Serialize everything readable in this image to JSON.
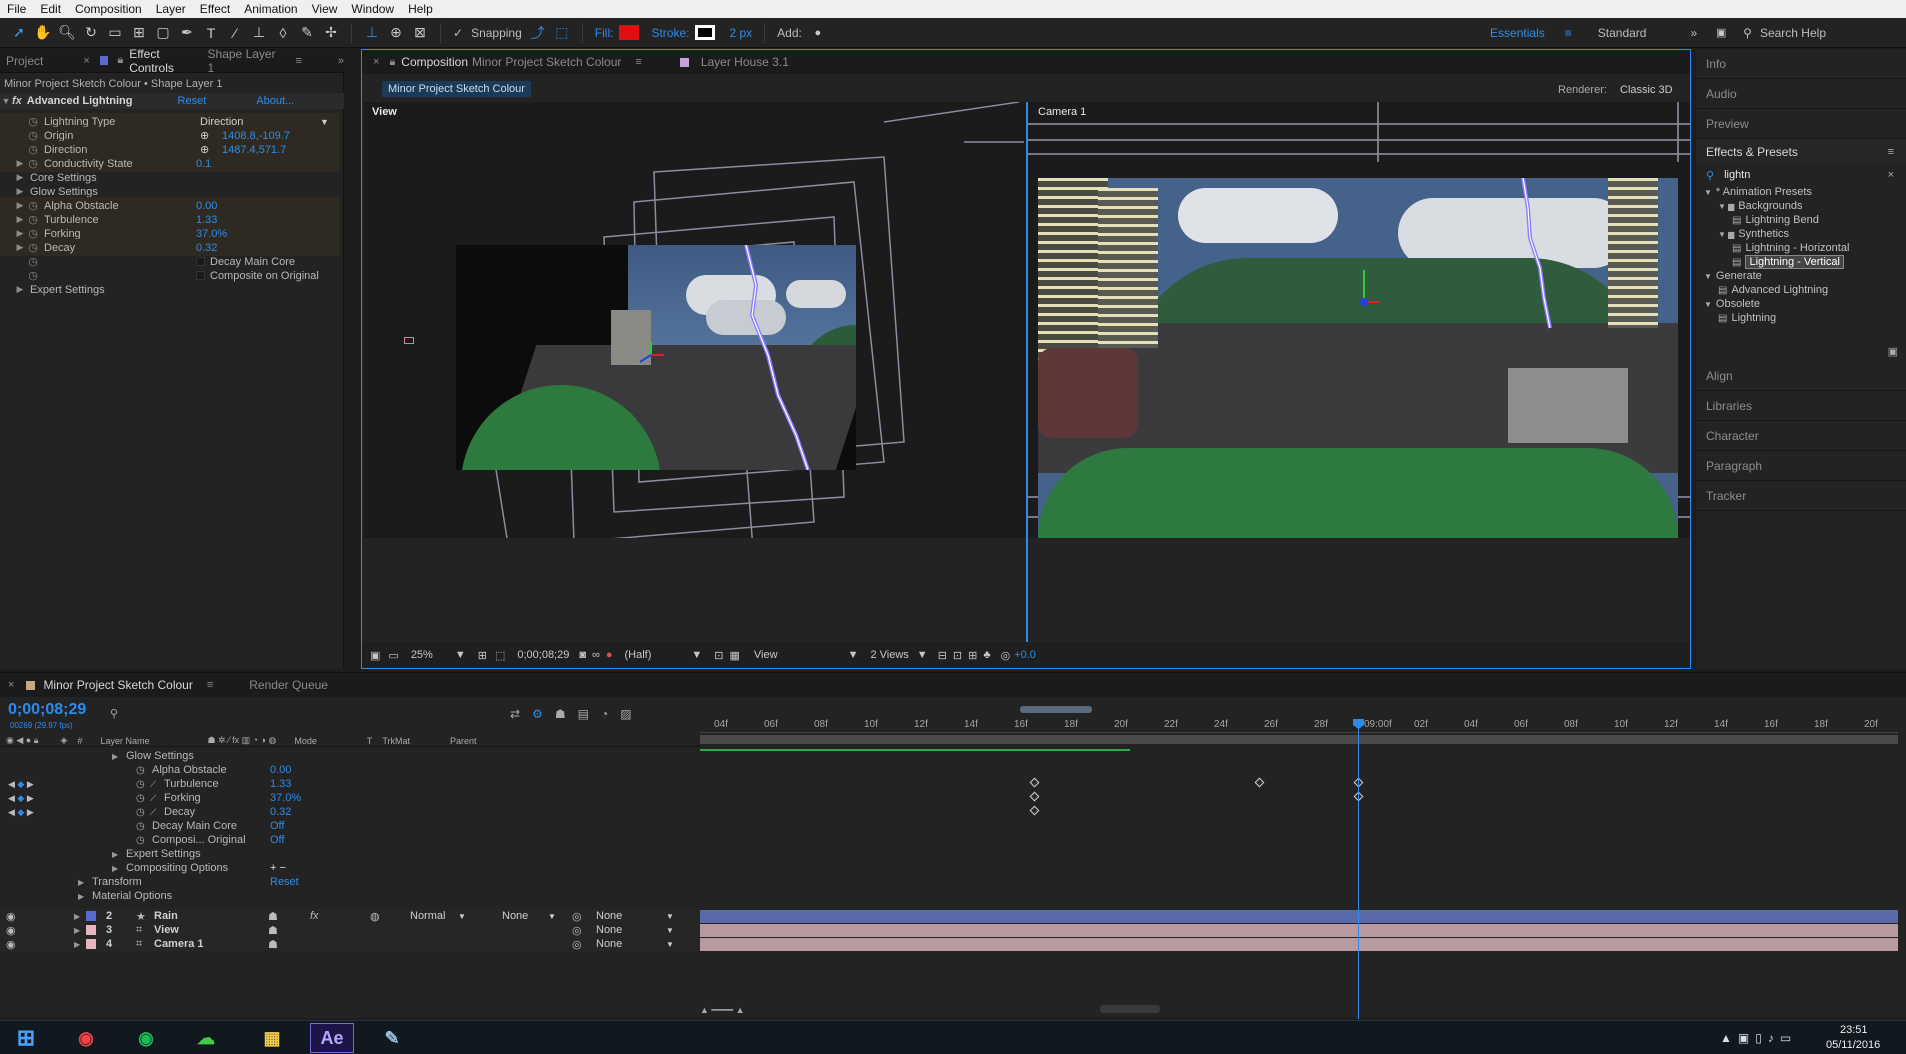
{
  "menu": [
    "File",
    "Edit",
    "Composition",
    "Layer",
    "Effect",
    "Animation",
    "View",
    "Window",
    "Help"
  ],
  "toolbar": {
    "snapping_label": "Snapping",
    "fill_label": "Fill:",
    "stroke_label": "Stroke:",
    "stroke_width": "2 px",
    "add_label": "Add:",
    "workspace_active": "Essentials",
    "workspace_other": "Standard",
    "search_help": "Search Help"
  },
  "colors": {
    "fill": "#e01010",
    "accent": "#2d8ceb",
    "rain_bar": "#5a6aa8",
    "pink_bar": "#b89aa0"
  },
  "left_panel": {
    "tab_project": "Project",
    "tab_effect_controls": "Effect Controls",
    "tab_effect_layer": "Shape Layer 1",
    "breadcrumb": "Minor Project Sketch Colour • Shape Layer 1",
    "effect_name": "Advanced Lightning",
    "reset": "Reset",
    "about": "About...",
    "rows": [
      {
        "label": "Lightning Type",
        "value": "Direction"
      },
      {
        "label": "Origin",
        "value": "1408.8,-109.7"
      },
      {
        "label": "Direction",
        "value": "1487.4,571.7"
      },
      {
        "label": "Conductivity State",
        "value": "0.1"
      },
      {
        "label": "Core Settings",
        "value": ""
      },
      {
        "label": "Glow Settings",
        "value": ""
      },
      {
        "label": "Alpha Obstacle",
        "value": "0.00"
      },
      {
        "label": "Turbulence",
        "value": "1.33"
      },
      {
        "label": "Forking",
        "value": "37.0%"
      },
      {
        "label": "Decay",
        "value": "0.32"
      },
      {
        "label": "",
        "value": "Decay Main Core"
      },
      {
        "label": "",
        "value": "Composite on Original"
      },
      {
        "label": "Expert Settings",
        "value": ""
      }
    ]
  },
  "composition": {
    "tab_label": "Composition",
    "tab_name": "Minor Project Sketch Colour",
    "tab_layer": "Layer House 3.1",
    "flowchart_chip": "Minor Project Sketch Colour",
    "renderer_label": "Renderer:",
    "renderer_value": "Classic 3D",
    "left_view_label": "View",
    "right_view_label": "Camera 1",
    "bottom": {
      "zoom": "25%",
      "timecode": "0;00;08;29",
      "resolution": "(Half)",
      "view": "View",
      "views": "2 Views",
      "exposure": "+0.0"
    }
  },
  "right_panel": {
    "items_top": [
      "Info",
      "Audio",
      "Preview"
    ],
    "effects_title": "Effects & Presets",
    "search_value": "lightn",
    "tree": [
      {
        "label": "* Animation Presets",
        "level": 0,
        "kind": "twirl"
      },
      {
        "label": "Backgrounds",
        "level": 1,
        "kind": "folder"
      },
      {
        "label": "Lightning Bend",
        "level": 2,
        "kind": "preset"
      },
      {
        "label": "Synthetics",
        "level": 1,
        "kind": "folder"
      },
      {
        "label": "Lightning - Horizontal",
        "level": 2,
        "kind": "preset"
      },
      {
        "label": "Lightning - Vertical",
        "level": 2,
        "kind": "preset-selected"
      },
      {
        "label": "Generate",
        "level": 0,
        "kind": "twirl"
      },
      {
        "label": "Advanced Lightning",
        "level": 1,
        "kind": "preset"
      },
      {
        "label": "Obsolete",
        "level": 0,
        "kind": "twirl"
      },
      {
        "label": "Lightning",
        "level": 1,
        "kind": "preset"
      }
    ],
    "items_bottom": [
      "Align",
      "Libraries",
      "Character",
      "Paragraph",
      "Tracker"
    ]
  },
  "timeline": {
    "tab_comp": "Minor Project Sketch Colour",
    "tab_render": "Render Queue",
    "timecode": "0;00;08;29",
    "frame_info": "00269 (29.97 fps)",
    "col_num": "#",
    "col_layer_name": "Layer Name",
    "col_mode": "Mode",
    "col_t": "T",
    "col_trkmat": "TrkMat",
    "col_parent": "Parent",
    "ruler": [
      "04f",
      "06f",
      "08f",
      "10f",
      "12f",
      "14f",
      "16f",
      "18f",
      "20f",
      "22f",
      "24f",
      "26f",
      "28f",
      "09:00f",
      "02f",
      "04f",
      "06f",
      "08f",
      "10f",
      "12f",
      "14f",
      "16f",
      "18f",
      "20f"
    ],
    "prop_rows": [
      {
        "label": "Glow Settings",
        "value": "",
        "indent": 1,
        "twirl": true
      },
      {
        "label": "Alpha Obstacle",
        "value": "0.00",
        "indent": 2
      },
      {
        "label": "Turbulence",
        "value": "1.33",
        "indent": 2,
        "graph": true
      },
      {
        "label": "Forking",
        "value": "37.0%",
        "indent": 2,
        "graph": true
      },
      {
        "label": "Decay",
        "value": "0.32",
        "indent": 2,
        "graph": true
      },
      {
        "label": "Decay Main Core",
        "value": "Off",
        "indent": 2
      },
      {
        "label": "Composi... Original",
        "value": "Off",
        "indent": 2
      },
      {
        "label": "Expert Settings",
        "value": "",
        "indent": 1,
        "twirl": true
      },
      {
        "label": "Compositing Options",
        "value": "+ −",
        "indent": 1,
        "twirl": true
      },
      {
        "label": "Transform",
        "value": "Reset",
        "indent": 0,
        "twirl": true
      },
      {
        "label": "Material Options",
        "value": "",
        "indent": 0,
        "twirl": true
      }
    ],
    "layers": [
      {
        "num": "2",
        "name": "Rain",
        "mode": "Normal",
        "trkmat": "None",
        "parent": "None",
        "color": "#5a6ad0"
      },
      {
        "num": "3",
        "name": "View",
        "mode": "",
        "trkmat": "",
        "parent": "None",
        "color": "#e6b5c0"
      },
      {
        "num": "4",
        "name": "Camera 1",
        "mode": "",
        "trkmat": "",
        "parent": "None",
        "color": "#e6b5c0"
      }
    ]
  },
  "taskbar": {
    "time": "23:51",
    "date": "05/11/2016"
  }
}
